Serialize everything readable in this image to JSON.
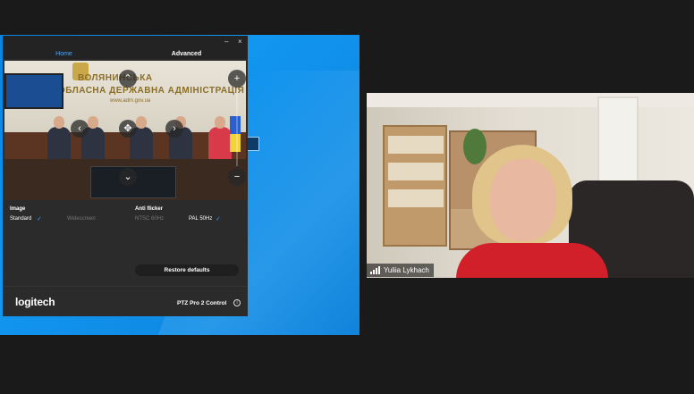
{
  "app": {
    "tabs": {
      "home": "Home",
      "advanced": "Advanced"
    },
    "window": {
      "minimize": "–",
      "close": "×"
    },
    "preview": {
      "sign_line1": "ВОЛЯНИНСЬКА",
      "sign_line2": "ОБЛАСНА ДЕРЖАВНА АДМІНІСТРАЦІЯ",
      "sign_line3": "www.adm.gov.ua",
      "controls": {
        "up": "⌃",
        "down": "⌄",
        "left": "‹",
        "right": "›",
        "center": "✥",
        "zoom_in": "+",
        "zoom_out": "−"
      }
    },
    "image": {
      "label": "Image",
      "options": [
        "Standard",
        "Widescreen"
      ],
      "selected": "Standard"
    },
    "anti_flicker": {
      "label": "Anti flicker",
      "options": [
        "NTSC 60Hz",
        "PAL 50Hz"
      ],
      "selected": "PAL 50Hz"
    },
    "check": "✓",
    "restore_label": "Restore defaults",
    "logo": "logitech",
    "product": "PTZ Pro 2 Control",
    "info": "i"
  },
  "participant": {
    "name": "Yuliia Lykhach"
  },
  "colors": {
    "accent": "#3a9cff",
    "desktop": "#1296f0",
    "app_bg": "#2b2b2b"
  }
}
